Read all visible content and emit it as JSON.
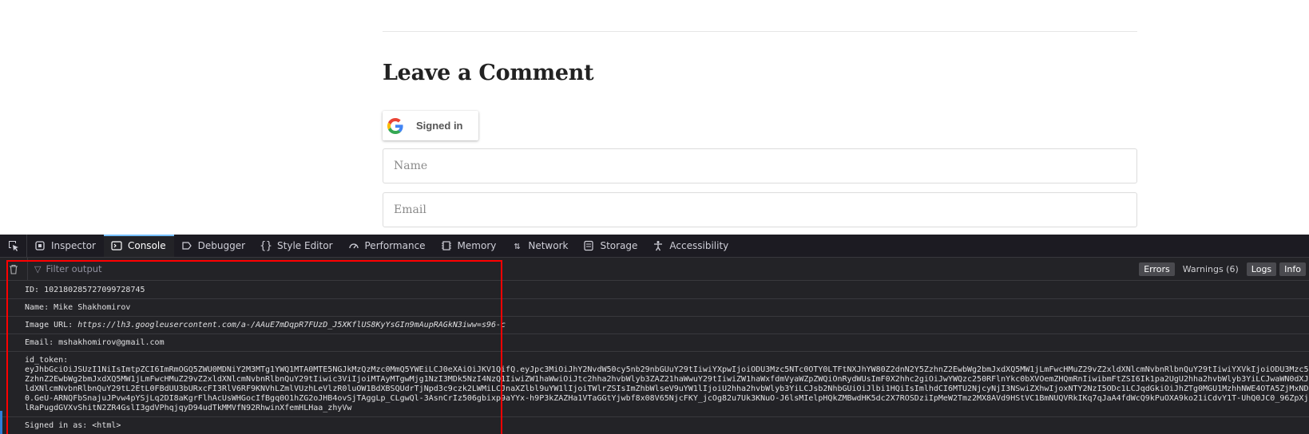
{
  "page": {
    "heading": "Leave a Comment",
    "google_button_label": "Signed in",
    "name_placeholder": "Name",
    "email_placeholder": "Email"
  },
  "devtools": {
    "tabs": [
      {
        "label": "Inspector",
        "icon": "inspector-icon"
      },
      {
        "label": "Console",
        "icon": "console-icon"
      },
      {
        "label": "Debugger",
        "icon": "debugger-icon"
      },
      {
        "label": "Style Editor",
        "icon": "style-editor-icon"
      },
      {
        "label": "Performance",
        "icon": "performance-icon"
      },
      {
        "label": "Memory",
        "icon": "memory-icon"
      },
      {
        "label": "Network",
        "icon": "network-icon"
      },
      {
        "label": "Storage",
        "icon": "storage-icon"
      },
      {
        "label": "Accessibility",
        "icon": "accessibility-icon"
      }
    ],
    "selected_tab": "Console",
    "filter_placeholder": "Filter output",
    "levels": {
      "errors": "Errors",
      "warnings": "Warnings (6)",
      "logs": "Logs",
      "info": "Info"
    },
    "console": {
      "id_line": "ID: 102180285727099728745",
      "name_line": "Name: Mike Shakhomirov",
      "image_url_prefix": "Image URL: ",
      "image_url": "https://lh3.googleusercontent.com/a-/AAuE7mDqpR7FUzD_J5XKflUS8KyYsGIn9mAupRAGkN3iww=s96-c",
      "email_line": "Email: mshakhomirov@gmail.com",
      "id_token_label": "id_token:",
      "id_token_lines": [
        "eyJhbGciOiJSUzI1NiIsImtpZCI6ImRmOGQ5ZWU0MDNiY2M3MTg1YWQ1MTA0MTE5NGJkMzQzMzc0MmQ5YWEiLCJ0eXAiOiJKV1QifQ.eyJpc3MiOiJhY2NvdW50cy5nb29nbGUuY29tIiwiYXpwIjoiODU3Mzc5NTc0OTY0LTFtNXJhYW80Z2dnN2Y5ZzhnZ2EwbWg2bmJxdXQ5MW1jLmFwcHMuZ29vZ2xldXNlcmNvbnRlbnQuY29tIiwiYXVkIjoiODU3Mzc5N",
        "ZzhnZ2EwbWg2bmJxdXQ5MW1jLmFwcHMuZ29vZ2xldXNlcmNvbnRlbnQuY29tIiwic3ViIjoiMTAyMTgwMjg1NzI3MDk5NzI4NzQ1IiwiZW1haWwiOiJtc2hha2hvbWlyb3ZAZ21haWwuY29tIiwiZW1haWxfdmVyaWZpZWQiOnRydWUsImF0X2hhc2giOiJwYWQzc250RFlnYkc0bXVOemZHQmRnIiwibmFtZSI6Ik1pa2UgU2hha2hvbWlyb3YiLCJwaWN0dXJlI",
        "ldXNlcmNvbnRlbnQuY29tL2EtL0FBdUU3bURxcFI3RlV6RF9KNVhLZmlVUzhLeVlzR0luOW1BdXBSQUdrTjNpd3c9czk2LWMiLCJnaXZlbl9uYW1lIjoiTWlrZSIsImZhbWlseV9uYW1lIjoiU2hha2hvbWlyb3YiLCJsb2NhbGUiOiJlbi1HQiIsImlhdCI6MTU2NjcyNjI3NSwiZXhwIjoxNTY2NzI5ODc1LCJqdGkiOiJhZTg0MGU1MzhhNWE4OTA5ZjMxNDQ",
        "0.GeU-ARNQFbSnajuJPvw4pYSjLq2DI8aKgrFlhAcUsWHGocIfBgq0O1hZG2oJHB4ovSjTAggLp_CLgwQl-3AsnCrIz506gbixp9aYYx-h9P3kZAZHa1VTaGGtYjwbf8x08V65NjcFKY_jcOg82u7Uk3KNuO-J6lsMIelpHQkZMBwdHK5dc2X7ROSDziIpMeW2Tmz2MX8AVd9HStVC1BmNUQVRkIKq7qJaA4fdWcQ9kPuOXA9ko21iCdvY1T-UhQ0JC0_96ZpXjL",
        "lRaPugdGVXvShitN2ZR4GslI3gdVPhqjqyD94udTkMMVfN92RhwinXfemHLHaa_zhyVw"
      ],
      "signed_in_line": "Signed in as: <html>"
    }
  },
  "colors": {
    "devtools_bg": "#232327",
    "toolbar_bg": "#1c1b22",
    "selected_tab_accent": "#75bfff",
    "highlight_box": "#ff0000"
  }
}
